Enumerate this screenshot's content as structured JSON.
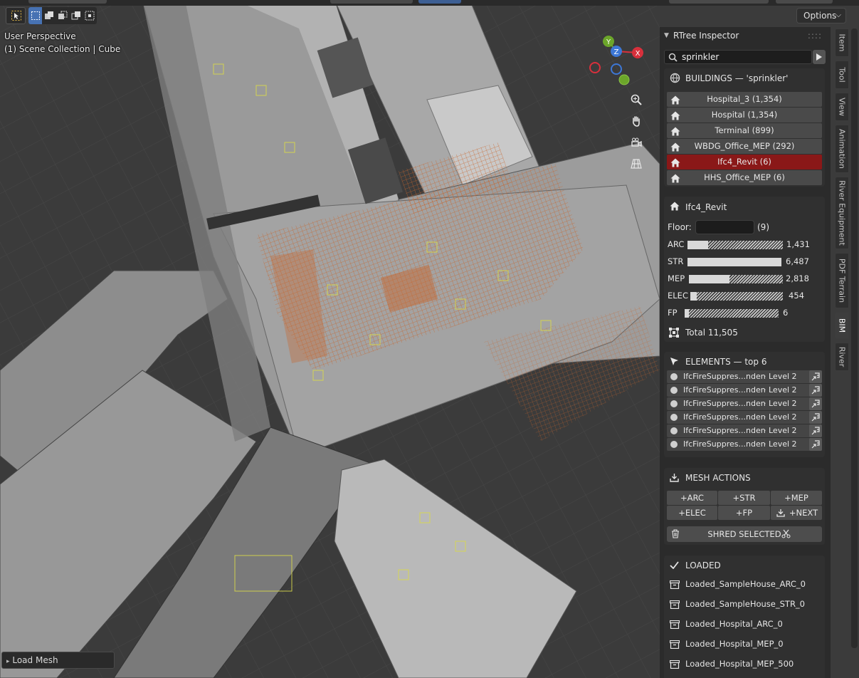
{
  "viewport": {
    "perspective_label": "User Perspective",
    "collection_label": "(1) Scene Collection | Cube",
    "options_label": "Options",
    "axis_labels": {
      "x": "X",
      "y": "Y",
      "z": "Z"
    },
    "load_mesh_label": "Load Mesh"
  },
  "sidebar_tabs": [
    "Item",
    "Tool",
    "View",
    "Animation",
    "River Equipment",
    "PDF Terrain",
    "BIM",
    "River"
  ],
  "active_tab": "BIM",
  "inspector": {
    "title": "RTree Inspector",
    "search_value": "sprinkler",
    "buildings": {
      "header": "BUILDINGS  — 'sprinkler'",
      "items": [
        {
          "label": "Hospital_3  (1,354)",
          "selected": false
        },
        {
          "label": "Hospital  (1,354)",
          "selected": false
        },
        {
          "label": "Terminal  (899)",
          "selected": false
        },
        {
          "label": "WBDG_Office_MEP  (292)",
          "selected": false
        },
        {
          "label": "Ifc4_Revit  (6)",
          "selected": true
        },
        {
          "label": "HHS_Office_MEP  (6)",
          "selected": false
        }
      ]
    },
    "detail": {
      "building_name": "Ifc4_Revit",
      "floor_label": "Floor:",
      "floor_count": "(9)",
      "disciplines": [
        {
          "label": "ARC",
          "value": "1,431",
          "fraction": 0.22
        },
        {
          "label": "STR",
          "value": "6,487",
          "fraction": 1.0
        },
        {
          "label": "MEP",
          "value": "2,818",
          "fraction": 0.43
        },
        {
          "label": "ELEC",
          "value": "454",
          "fraction": 0.07
        },
        {
          "label": "FP",
          "value": "6",
          "fraction": 0.02
        }
      ],
      "total_label": "Total  11,505"
    },
    "elements": {
      "header": "ELEMENTS — top 6",
      "items": [
        {
          "name": "IfcFireSuppres...nden",
          "level": "·  Level 2"
        },
        {
          "name": "IfcFireSuppres...nden",
          "level": "·  Level 2"
        },
        {
          "name": "IfcFireSuppres...nden",
          "level": "·  Level 2"
        },
        {
          "name": "IfcFireSuppres...nden",
          "level": "·  Level 2"
        },
        {
          "name": "IfcFireSuppres...nden",
          "level": "·  Level 2"
        },
        {
          "name": "IfcFireSuppres...nden",
          "level": "·  Level 2"
        }
      ]
    },
    "mesh_actions": {
      "header": "MESH ACTIONS",
      "buttons": [
        "+ARC",
        "+STR",
        "+MEP",
        "+ELEC",
        "+FP",
        "+NEXT"
      ],
      "shred_label": "SHRED SELECTED"
    },
    "loaded": {
      "header": "LOADED",
      "items": [
        "Loaded_SampleHouse_ARC_0",
        "Loaded_SampleHouse_STR_0",
        "Loaded_Hospital_ARC_0",
        "Loaded_Hospital_MEP_0",
        "Loaded_Hospital_MEP_500"
      ]
    }
  },
  "colors": {
    "selected_row": "#8a1818",
    "accent_blue": "#4772b3",
    "axis_x": "#d8303c",
    "axis_y": "#6ca62a",
    "axis_z": "#3d77d6",
    "mep_orange": "#c8642a"
  }
}
